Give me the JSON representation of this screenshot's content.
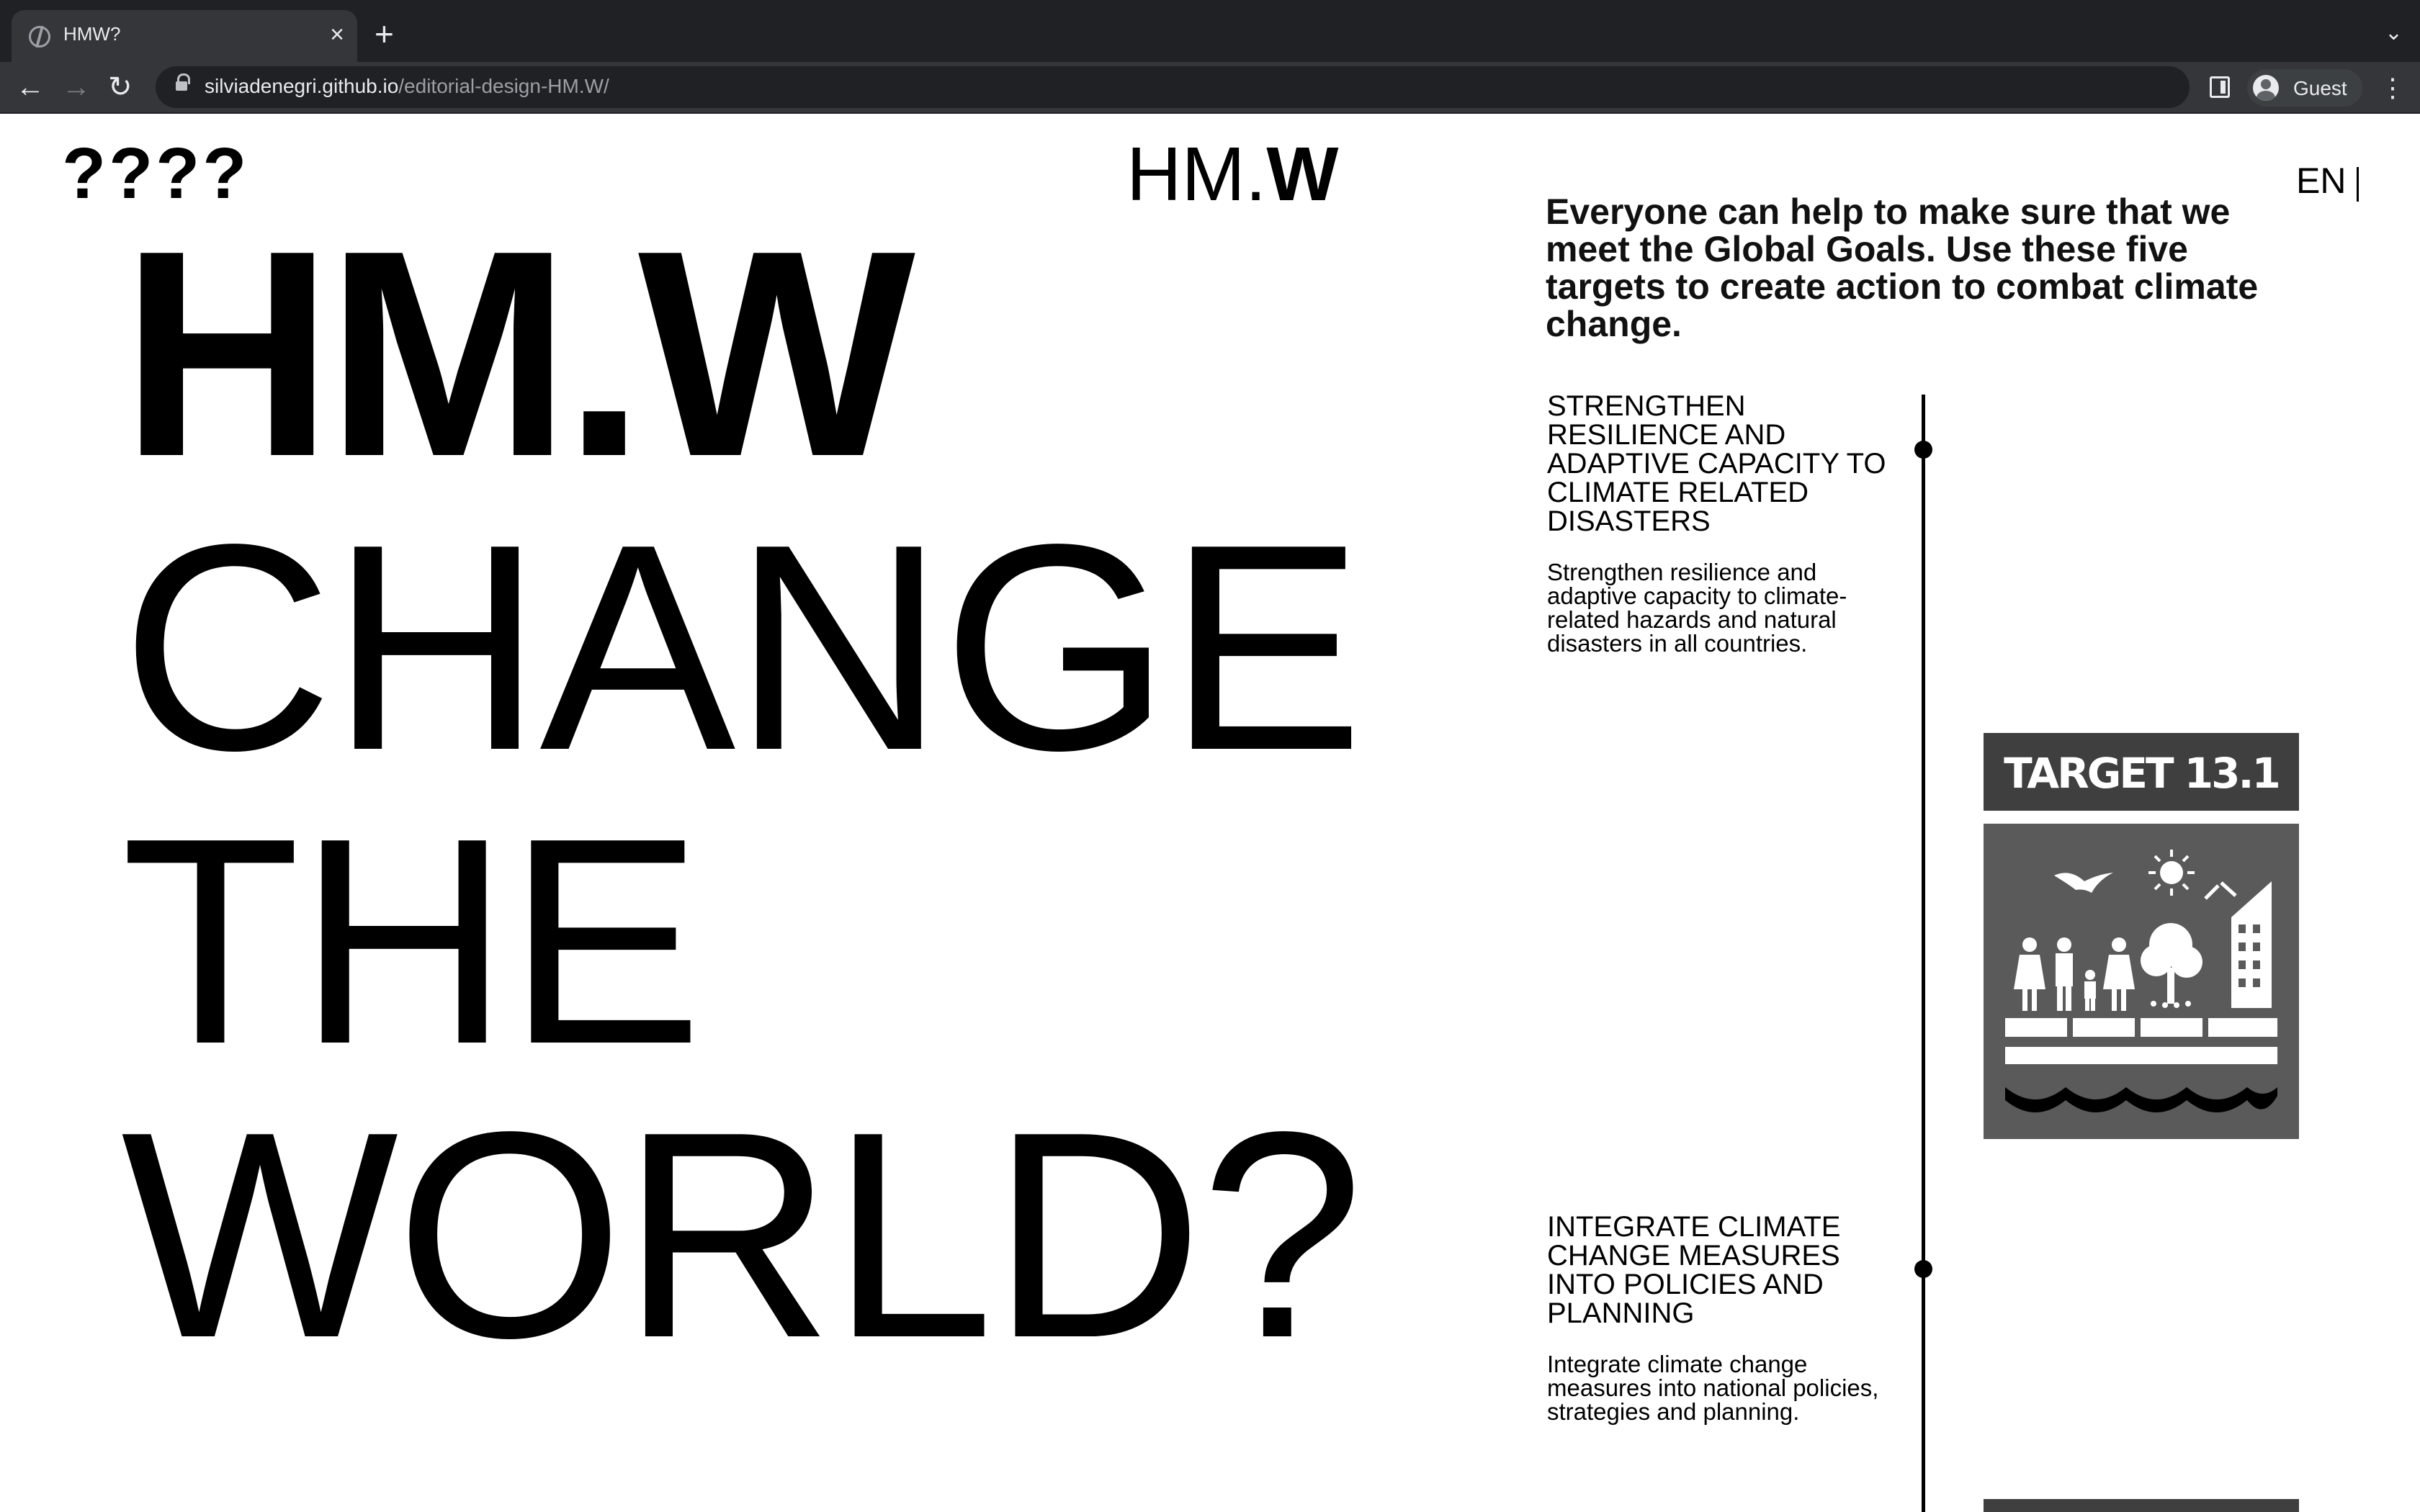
{
  "browser": {
    "tab_title": "HMW?",
    "tab_close": "×",
    "new_tab": "+",
    "tab_menu": "⌄",
    "back": "←",
    "forward": "→",
    "reload": "↻",
    "url_host": "silviadenegri.github.io",
    "url_path": "/editorial-design-HM.W/",
    "profile_name": "Guest",
    "menu": "⋮"
  },
  "header": {
    "qmarks": "????",
    "logo_light": "HM.",
    "logo_bold": "W",
    "language": "EN"
  },
  "hero": {
    "line1": "HM.W",
    "line2": "CHANGE",
    "line3": "THE",
    "line4": "WORLD?"
  },
  "intro": "Everyone can help to make sure that we meet the Global Goals. Use these five targets to create action to combat climate change.",
  "targets": [
    {
      "title": "Strengthen resilience and adaptive capacity to climate related disasters",
      "description": "Strengthen resilience and adaptive capacity to climate-related hazards and natural disasters in all countries.",
      "badge_label": "TARGET 13.1"
    },
    {
      "title": "Integrate climate change measures into policies and planning",
      "description": "Integrate climate change measures into national policies, strategies and planning."
    }
  ],
  "colors": {
    "badge_dark": "#3f3f3f",
    "badge_body": "#5a5a5a",
    "text": "#000000"
  }
}
